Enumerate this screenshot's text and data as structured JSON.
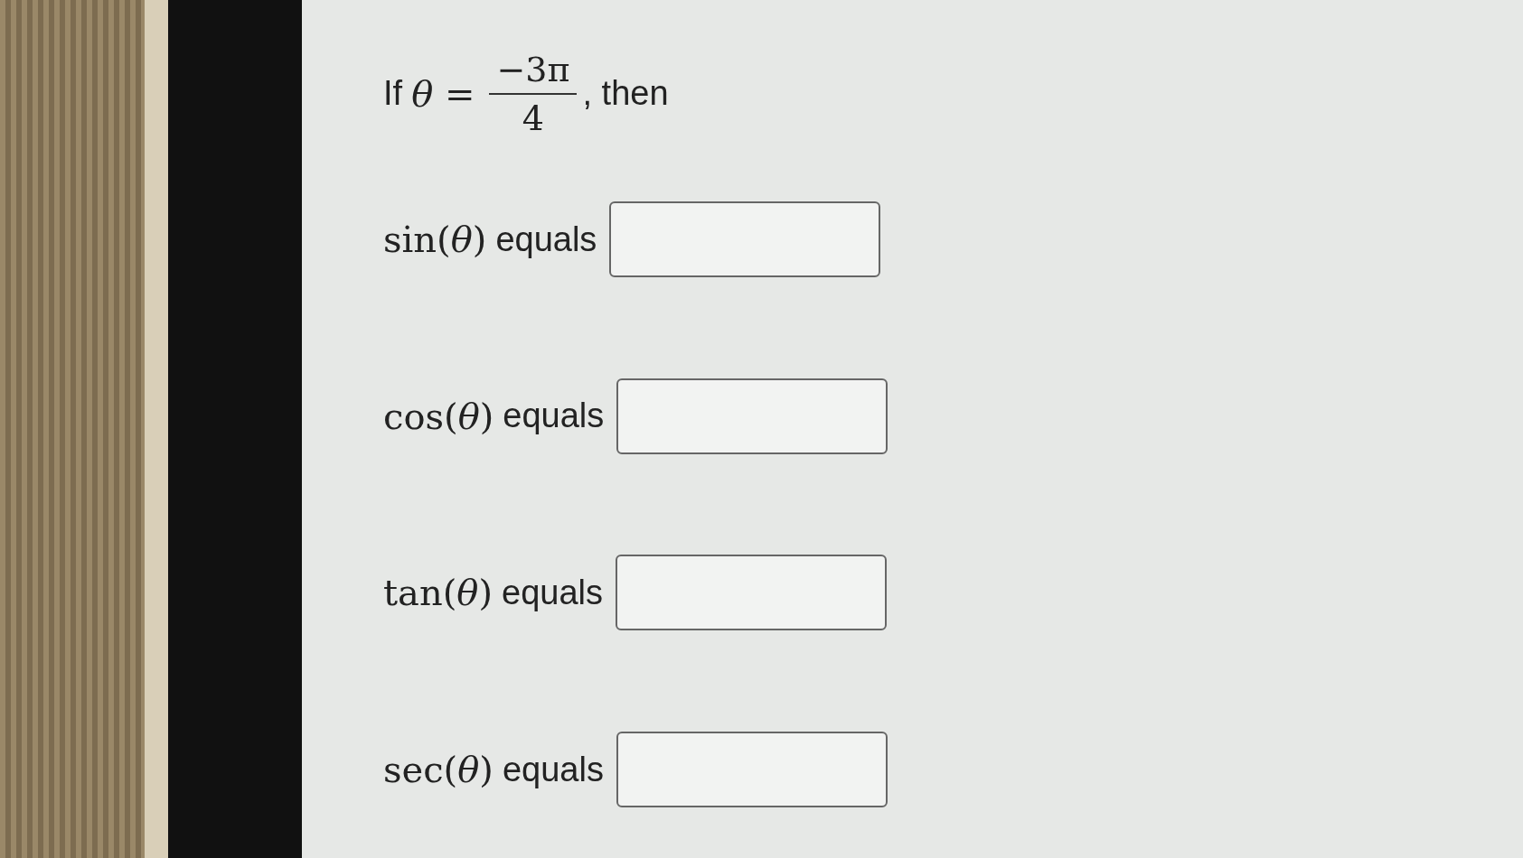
{
  "question": {
    "intro": "If",
    "variable": "*θ* =",
    "numerator": "−3π",
    "denominator": "4",
    "outro": ", then"
  },
  "rows": [
    {
      "function": "sin(*θ*)",
      "word": "equals",
      "value": ""
    },
    {
      "function": "cos(*θ*)",
      "word": "equals",
      "value": ""
    },
    {
      "function": "tan(*θ*)",
      "word": "equals",
      "value": ""
    },
    {
      "function": "sec(*θ*)",
      "word": "equals",
      "value": ""
    }
  ]
}
